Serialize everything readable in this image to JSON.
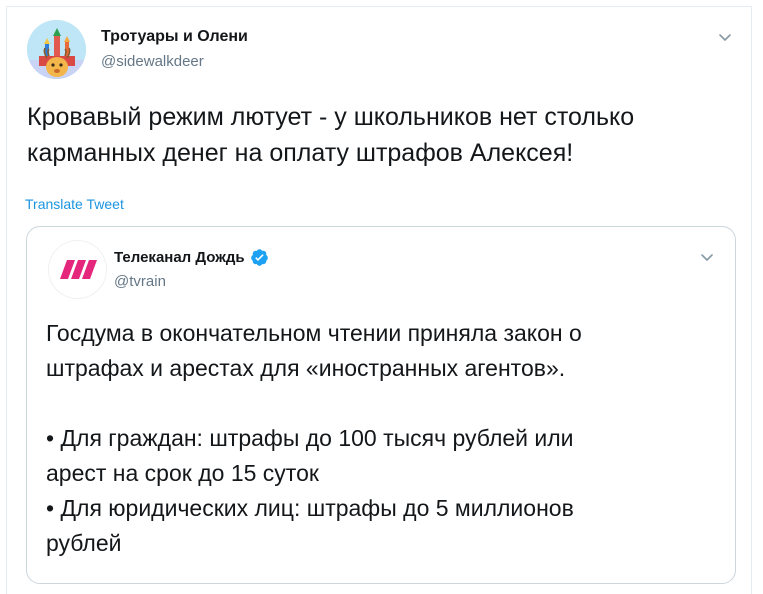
{
  "tweet": {
    "author": {
      "name": "Тротуары и Олени",
      "handle": "@sidewalkdeer"
    },
    "text": "Кровавый режим лютует - у школьников нет столько\nкарманных денег на оплату штрафов Алексея!",
    "translate_label": "Translate Tweet",
    "menu_icon": "chevron-down-icon"
  },
  "quoted_tweet": {
    "author": {
      "name": "Телеканал Дождь",
      "handle": "@tvrain",
      "verified": true
    },
    "text": "Госдума в окончательном чтении приняла закон о\nштрафах и арестах для «иностранных агентов».\n\n• Для граждан: штрафы до 100 тысяч рублей или\nарест на срок до 15 суток\n• Для юридических лиц: штрафы до 5 миллионов\nрублей",
    "menu_icon": "chevron-down-icon"
  },
  "colors": {
    "link": "#1b95e0",
    "verified_badge": "#1da1f2",
    "secondary_text": "#657786",
    "border": "#ccd6dd",
    "dozhd_logo": "#e5267d"
  }
}
